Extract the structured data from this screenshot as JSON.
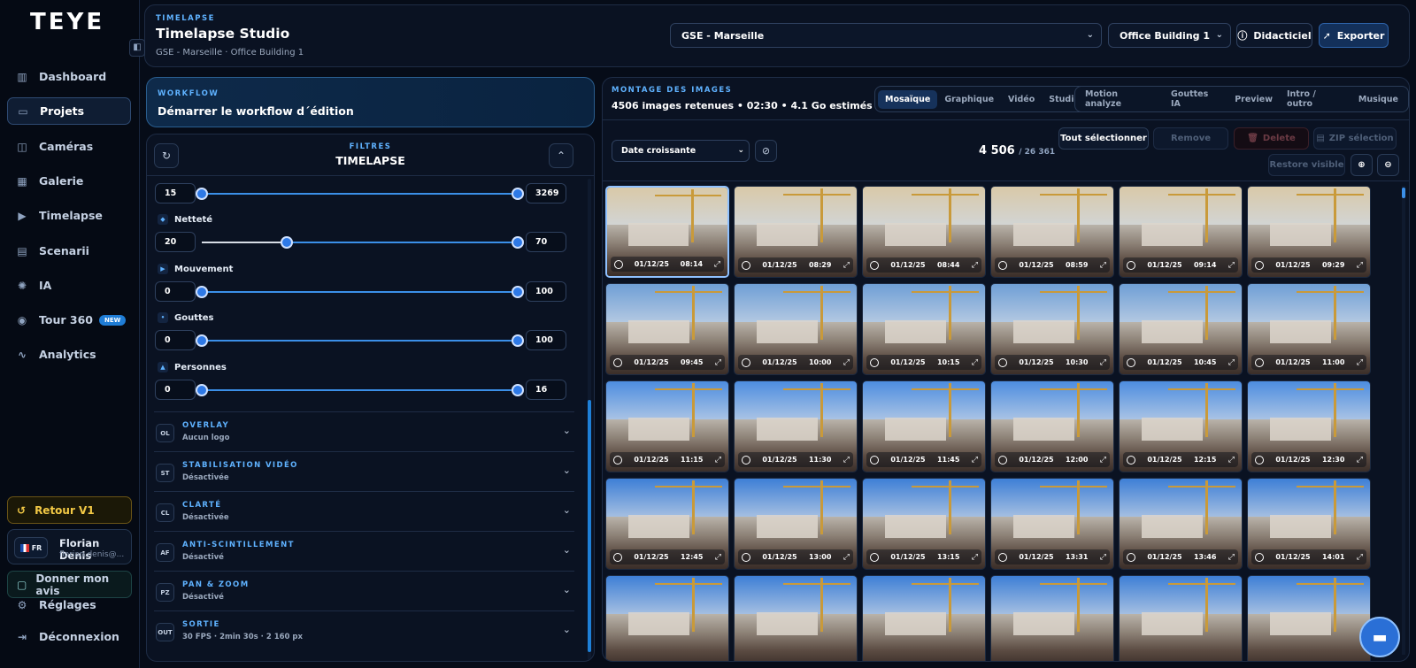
{
  "brand": {
    "logo": "TEYE"
  },
  "sidebar": {
    "items": [
      {
        "label": "Dashboard",
        "icon": "bar-chart-icon",
        "glyph": "▥"
      },
      {
        "label": "Projets",
        "icon": "folder-icon",
        "glyph": "▭"
      },
      {
        "label": "Caméras",
        "icon": "camera-icon",
        "glyph": "◫"
      },
      {
        "label": "Galerie",
        "icon": "gallery-icon",
        "glyph": "▦"
      },
      {
        "label": "Timelapse",
        "icon": "video-icon",
        "glyph": "▶"
      },
      {
        "label": "Scenarii",
        "icon": "film-icon",
        "glyph": "▤"
      },
      {
        "label": "IA",
        "icon": "brain-icon",
        "glyph": "✺"
      },
      {
        "label": "Tour 360",
        "icon": "person-icon",
        "glyph": "◉"
      },
      {
        "label": "Analytics",
        "icon": "activity-icon",
        "glyph": "∿"
      }
    ],
    "new_badge": "NEW",
    "retour": "Retour V1",
    "user_name": "Florian Denis",
    "user_email": "florian.denis@...",
    "lang": "FR",
    "feedback": "Donner mon avis",
    "settings": "Réglages",
    "logout": "Déconnexion"
  },
  "header": {
    "kicker": "TIMELAPSE",
    "title": "Timelapse Studio",
    "subtitle": "GSE - Marseille · Office Building 1",
    "site_select": "GSE - Marseille",
    "building_select": "Office Building 1",
    "tutorial": "Didacticiel",
    "export": "Exporter"
  },
  "workflow": {
    "kicker": "WORKFLOW",
    "title": "Démarrer le workflow d´édition"
  },
  "filters": {
    "kicker": "FILTRES",
    "title": "TIMELAPSE",
    "ranges": [
      {
        "label": "",
        "min": "15",
        "max": "3269",
        "lo": 0.0,
        "hi": 1.0
      },
      {
        "label": "Netteté",
        "min": "20",
        "max": "70",
        "lo": 0.27,
        "hi": 1.0
      },
      {
        "label": "Mouvement",
        "min": "0",
        "max": "100",
        "lo": 0.0,
        "hi": 1.0
      },
      {
        "label": "Gouttes",
        "min": "0",
        "max": "100",
        "lo": 0.0,
        "hi": 1.0
      },
      {
        "label": "Personnes",
        "min": "0",
        "max": "16",
        "lo": 0.0,
        "hi": 1.0
      }
    ],
    "sections": [
      {
        "tag": "OL",
        "title": "OVERLAY",
        "status": "Aucun logo"
      },
      {
        "tag": "ST",
        "title": "STABILISATION VIDÉO",
        "status": "Désactivée"
      },
      {
        "tag": "CL",
        "title": "CLARTÉ",
        "status": "Désactivée"
      },
      {
        "tag": "AF",
        "title": "ANTI-SCINTILLEMENT",
        "status": "Désactivé"
      },
      {
        "tag": "PZ",
        "title": "PAN & ZOOM",
        "status": "Désactivé"
      },
      {
        "tag": "OUT",
        "title": "SORTIE",
        "status": "30 FPS · 2min 30s · 2 160 px"
      }
    ]
  },
  "montage": {
    "kicker": "MONTAGE DES IMAGES",
    "summary": "4506 images retenues • 02:30 • 4.1 Go estimés",
    "view_tabs": [
      "Mosaïque",
      "Graphique",
      "Vidéo",
      "Studio"
    ],
    "tool_tabs": [
      "Motion analyze",
      "Gouttes IA",
      "Preview",
      "Intro / outro",
      "Musique"
    ],
    "sort": "Date croissante",
    "count": "4 506",
    "total": "/ 26 361",
    "select_all": "Tout sélectionner",
    "remove": "Remove",
    "delete": "Delete",
    "zip": "ZIP sélection",
    "restore": "Restore visible",
    "colors": {
      "accent": "#2e79e6",
      "warning": "#f3c945"
    }
  },
  "thumbnails": [
    {
      "date": "01/12/25",
      "time": "08:14"
    },
    {
      "date": "01/12/25",
      "time": "08:29"
    },
    {
      "date": "01/12/25",
      "time": "08:44"
    },
    {
      "date": "01/12/25",
      "time": "08:59"
    },
    {
      "date": "01/12/25",
      "time": "09:14"
    },
    {
      "date": "01/12/25",
      "time": "09:29"
    },
    {
      "date": "01/12/25",
      "time": "09:45"
    },
    {
      "date": "01/12/25",
      "time": "10:00"
    },
    {
      "date": "01/12/25",
      "time": "10:15"
    },
    {
      "date": "01/12/25",
      "time": "10:30"
    },
    {
      "date": "01/12/25",
      "time": "10:45"
    },
    {
      "date": "01/12/25",
      "time": "11:00"
    },
    {
      "date": "01/12/25",
      "time": "11:15"
    },
    {
      "date": "01/12/25",
      "time": "11:30"
    },
    {
      "date": "01/12/25",
      "time": "11:45"
    },
    {
      "date": "01/12/25",
      "time": "12:00"
    },
    {
      "date": "01/12/25",
      "time": "12:15"
    },
    {
      "date": "01/12/25",
      "time": "12:30"
    },
    {
      "date": "01/12/25",
      "time": "12:45"
    },
    {
      "date": "01/12/25",
      "time": "13:00"
    },
    {
      "date": "01/12/25",
      "time": "13:15"
    },
    {
      "date": "01/12/25",
      "time": "13:31"
    },
    {
      "date": "01/12/25",
      "time": "13:46"
    },
    {
      "date": "01/12/25",
      "time": "14:01"
    },
    {
      "date": "",
      "time": ""
    },
    {
      "date": "",
      "time": ""
    },
    {
      "date": "",
      "time": ""
    },
    {
      "date": "",
      "time": ""
    },
    {
      "date": "",
      "time": ""
    },
    {
      "date": "",
      "time": ""
    }
  ]
}
